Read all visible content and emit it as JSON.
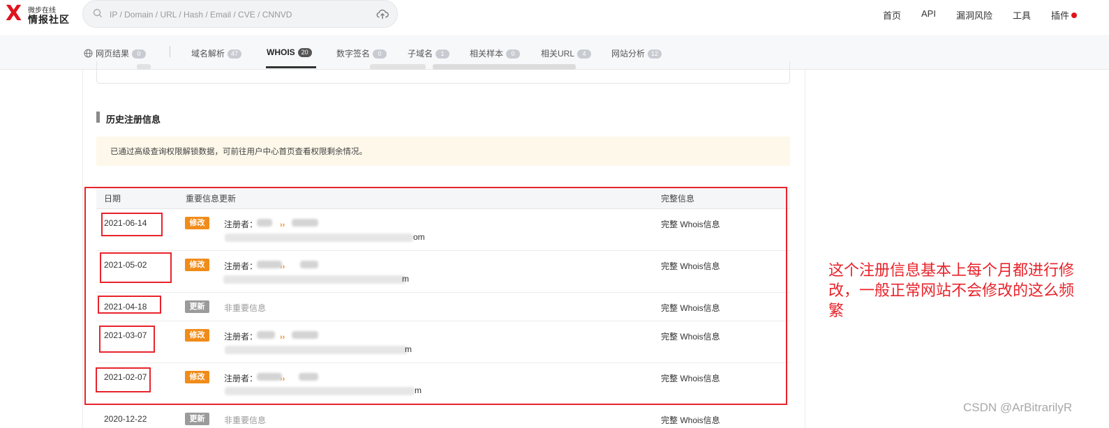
{
  "header": {
    "logo_mark": "X",
    "logo_small": "微步在线",
    "logo_big": "情报社区",
    "search_placeholder": "IP / Domain / URL / Hash / Email / CVE / CNNVD",
    "nav": [
      "首页",
      "API",
      "漏洞风险",
      "工具",
      "插件"
    ]
  },
  "tabs": [
    {
      "label": "网页结果",
      "count": "0"
    },
    {
      "label": "域名解析",
      "count": "47"
    },
    {
      "label": "WHOIS",
      "count": "20",
      "active": true
    },
    {
      "label": "数字签名",
      "count": "0"
    },
    {
      "label": "子域名",
      "count": "1"
    },
    {
      "label": "相关样本",
      "count": "0"
    },
    {
      "label": "相关URL",
      "count": "4"
    },
    {
      "label": "网站分析",
      "count": "12"
    }
  ],
  "section": {
    "title": "历史注册信息",
    "notice": "已通过高级查询权限解锁数据，可前往用户中心首页查看权限剩余情况。"
  },
  "table": {
    "headers": [
      "日期",
      "重要信息更新",
      "完整信息"
    ],
    "rows": [
      {
        "date": "2021-06-14",
        "tag": "修改",
        "line1_label": "注册者：",
        "line1_arrow": "››",
        "line2_tail": "om",
        "link": "完整 Whois信息"
      },
      {
        "date": "2021-05-02",
        "tag": "修改",
        "line1_label": "注册者：",
        "line1_arrow": "››",
        "line2_tail": "m",
        "link": "完整 Whois信息"
      },
      {
        "date": "2021-04-18",
        "tag": "更新",
        "info": "非重要信息",
        "link": "完整 Whois信息"
      },
      {
        "date": "2021-03-07",
        "tag": "修改",
        "line1_label": "注册者：",
        "line1_arrow": "››",
        "line2_tail": "m",
        "link": "完整 Whois信息"
      },
      {
        "date": "2021-02-07",
        "tag": "修改",
        "line1_label": "注册者：",
        "line1_arrow": "››",
        "line2_tail": "m",
        "link": "完整 Whois信息"
      },
      {
        "date": "2020-12-22",
        "tag": "更新",
        "info": "非重要信息",
        "link": "完整 Whois信息"
      }
    ]
  },
  "annotation": "这个注册信息基本上每个月都进行修改，一般正常网站不会修改的这么频繁",
  "watermark": "CSDN @ArBitrarilyR",
  "colors": {
    "brand_red": "#e0141e",
    "tag_modify": "#f08c1a",
    "tag_update": "#9b9b9b",
    "annotation_red": "#e8232b",
    "notice_bg": "#fdf8ea"
  }
}
